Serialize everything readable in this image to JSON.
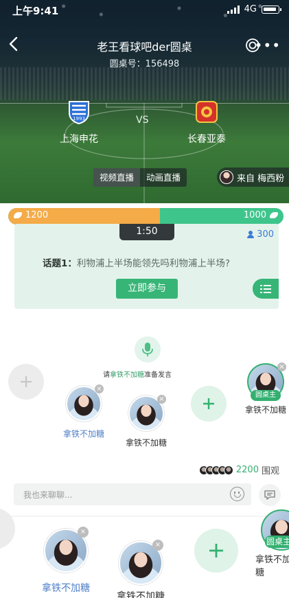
{
  "status_bar": {
    "time": "上午9:41",
    "network": "4G"
  },
  "header": {
    "title": "老王看球吧der圆桌",
    "room_label": "圆桌号：156498"
  },
  "match": {
    "home_team": "上海申花",
    "away_team": "长春亚泰",
    "vs": "VS",
    "home_color": "#2a6fd6",
    "away_color": "#d3332a"
  },
  "live_tabs": [
    {
      "label": "视频直播",
      "active": true
    },
    {
      "label": "动画直播",
      "active": false
    }
  ],
  "source": {
    "label": "来自 梅西粉"
  },
  "vote": {
    "left_count": "1200",
    "right_count": "1000",
    "left_share": 0.55,
    "left_color": "#f4ab48",
    "right_color": "#3ec58c"
  },
  "quiz": {
    "timer": "1:50",
    "participants": "300",
    "topic_prefix": "话题1：",
    "question": "利物浦上半场能领先吗利物浦上半场?",
    "join_label": "立即参与"
  },
  "mic": {
    "hint_prefix": "请",
    "hint_name": "拿铁不加糖",
    "hint_suffix": "准备发言"
  },
  "seats": {
    "host_tag": "圆桌主",
    "host_name": "拿铁不加糖",
    "seat1_name": "拿铁不加糖",
    "seat2_name": "拿铁不加糖"
  },
  "viewers": {
    "count": "2200",
    "label": "围观"
  },
  "chat": {
    "placeholder": "我也来聊聊..."
  },
  "duplicate": {
    "host_tag": "圆桌主",
    "host_name": "拿铁不加糖",
    "seat1_name": "拿铁不加糖",
    "seat2_name": "拿铁不加糖"
  },
  "accent_color": "#33b070"
}
